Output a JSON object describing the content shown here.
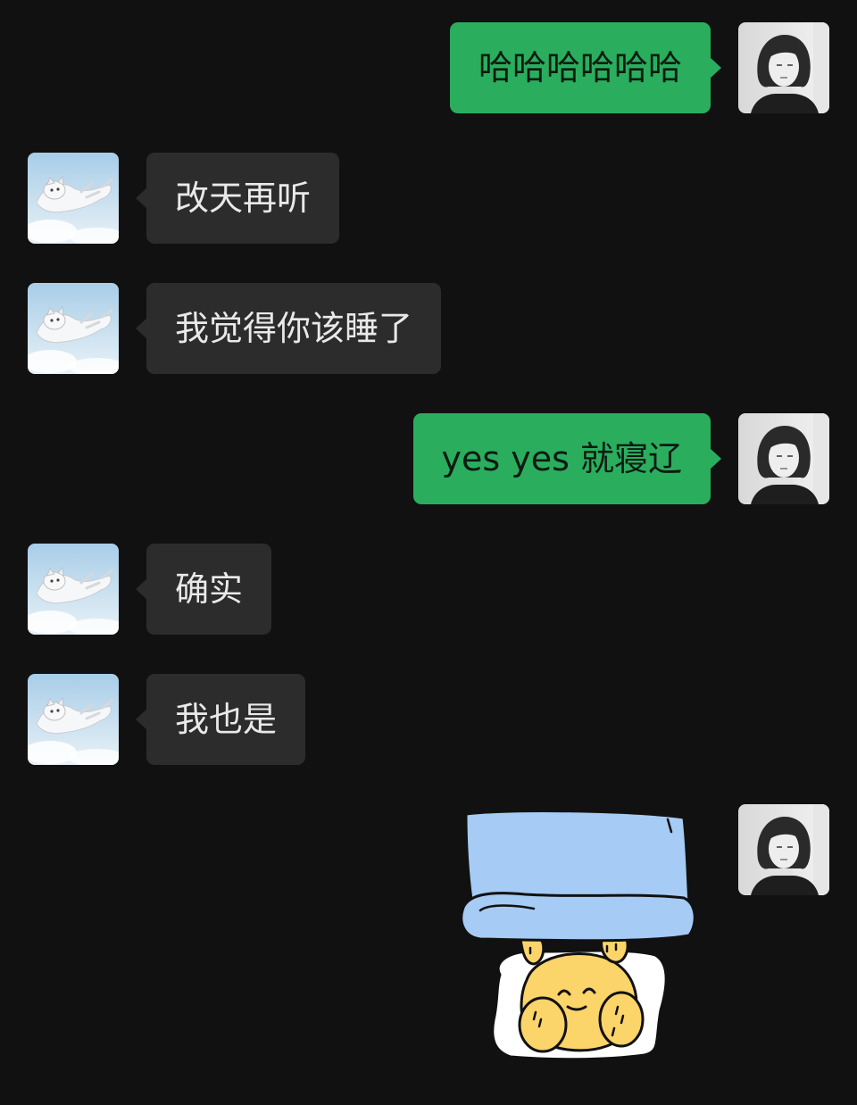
{
  "colors": {
    "background": "#111111",
    "incoming_bubble": "#2c2c2c",
    "outgoing_bubble": "#2aae5e",
    "incoming_text": "#e9e9e9",
    "outgoing_text": "#0d1a11"
  },
  "messages": [
    {
      "side": "outgoing",
      "avatar": "woman-portrait-icon",
      "text": "哈哈哈哈哈哈"
    },
    {
      "side": "incoming",
      "avatar": "cloud-cat-icon",
      "text": "改天再听"
    },
    {
      "side": "incoming",
      "avatar": "cloud-cat-icon",
      "text": "我觉得你该睡了"
    },
    {
      "side": "outgoing",
      "avatar": "woman-portrait-icon",
      "text": "yes yes 就寝辽"
    },
    {
      "side": "incoming",
      "avatar": "cloud-cat-icon",
      "text": "确实"
    },
    {
      "side": "incoming",
      "avatar": "cloud-cat-icon",
      "text": "我也是"
    },
    {
      "side": "outgoing",
      "avatar": "woman-portrait-icon",
      "sticker": "sleeping-bear-sticker"
    }
  ]
}
